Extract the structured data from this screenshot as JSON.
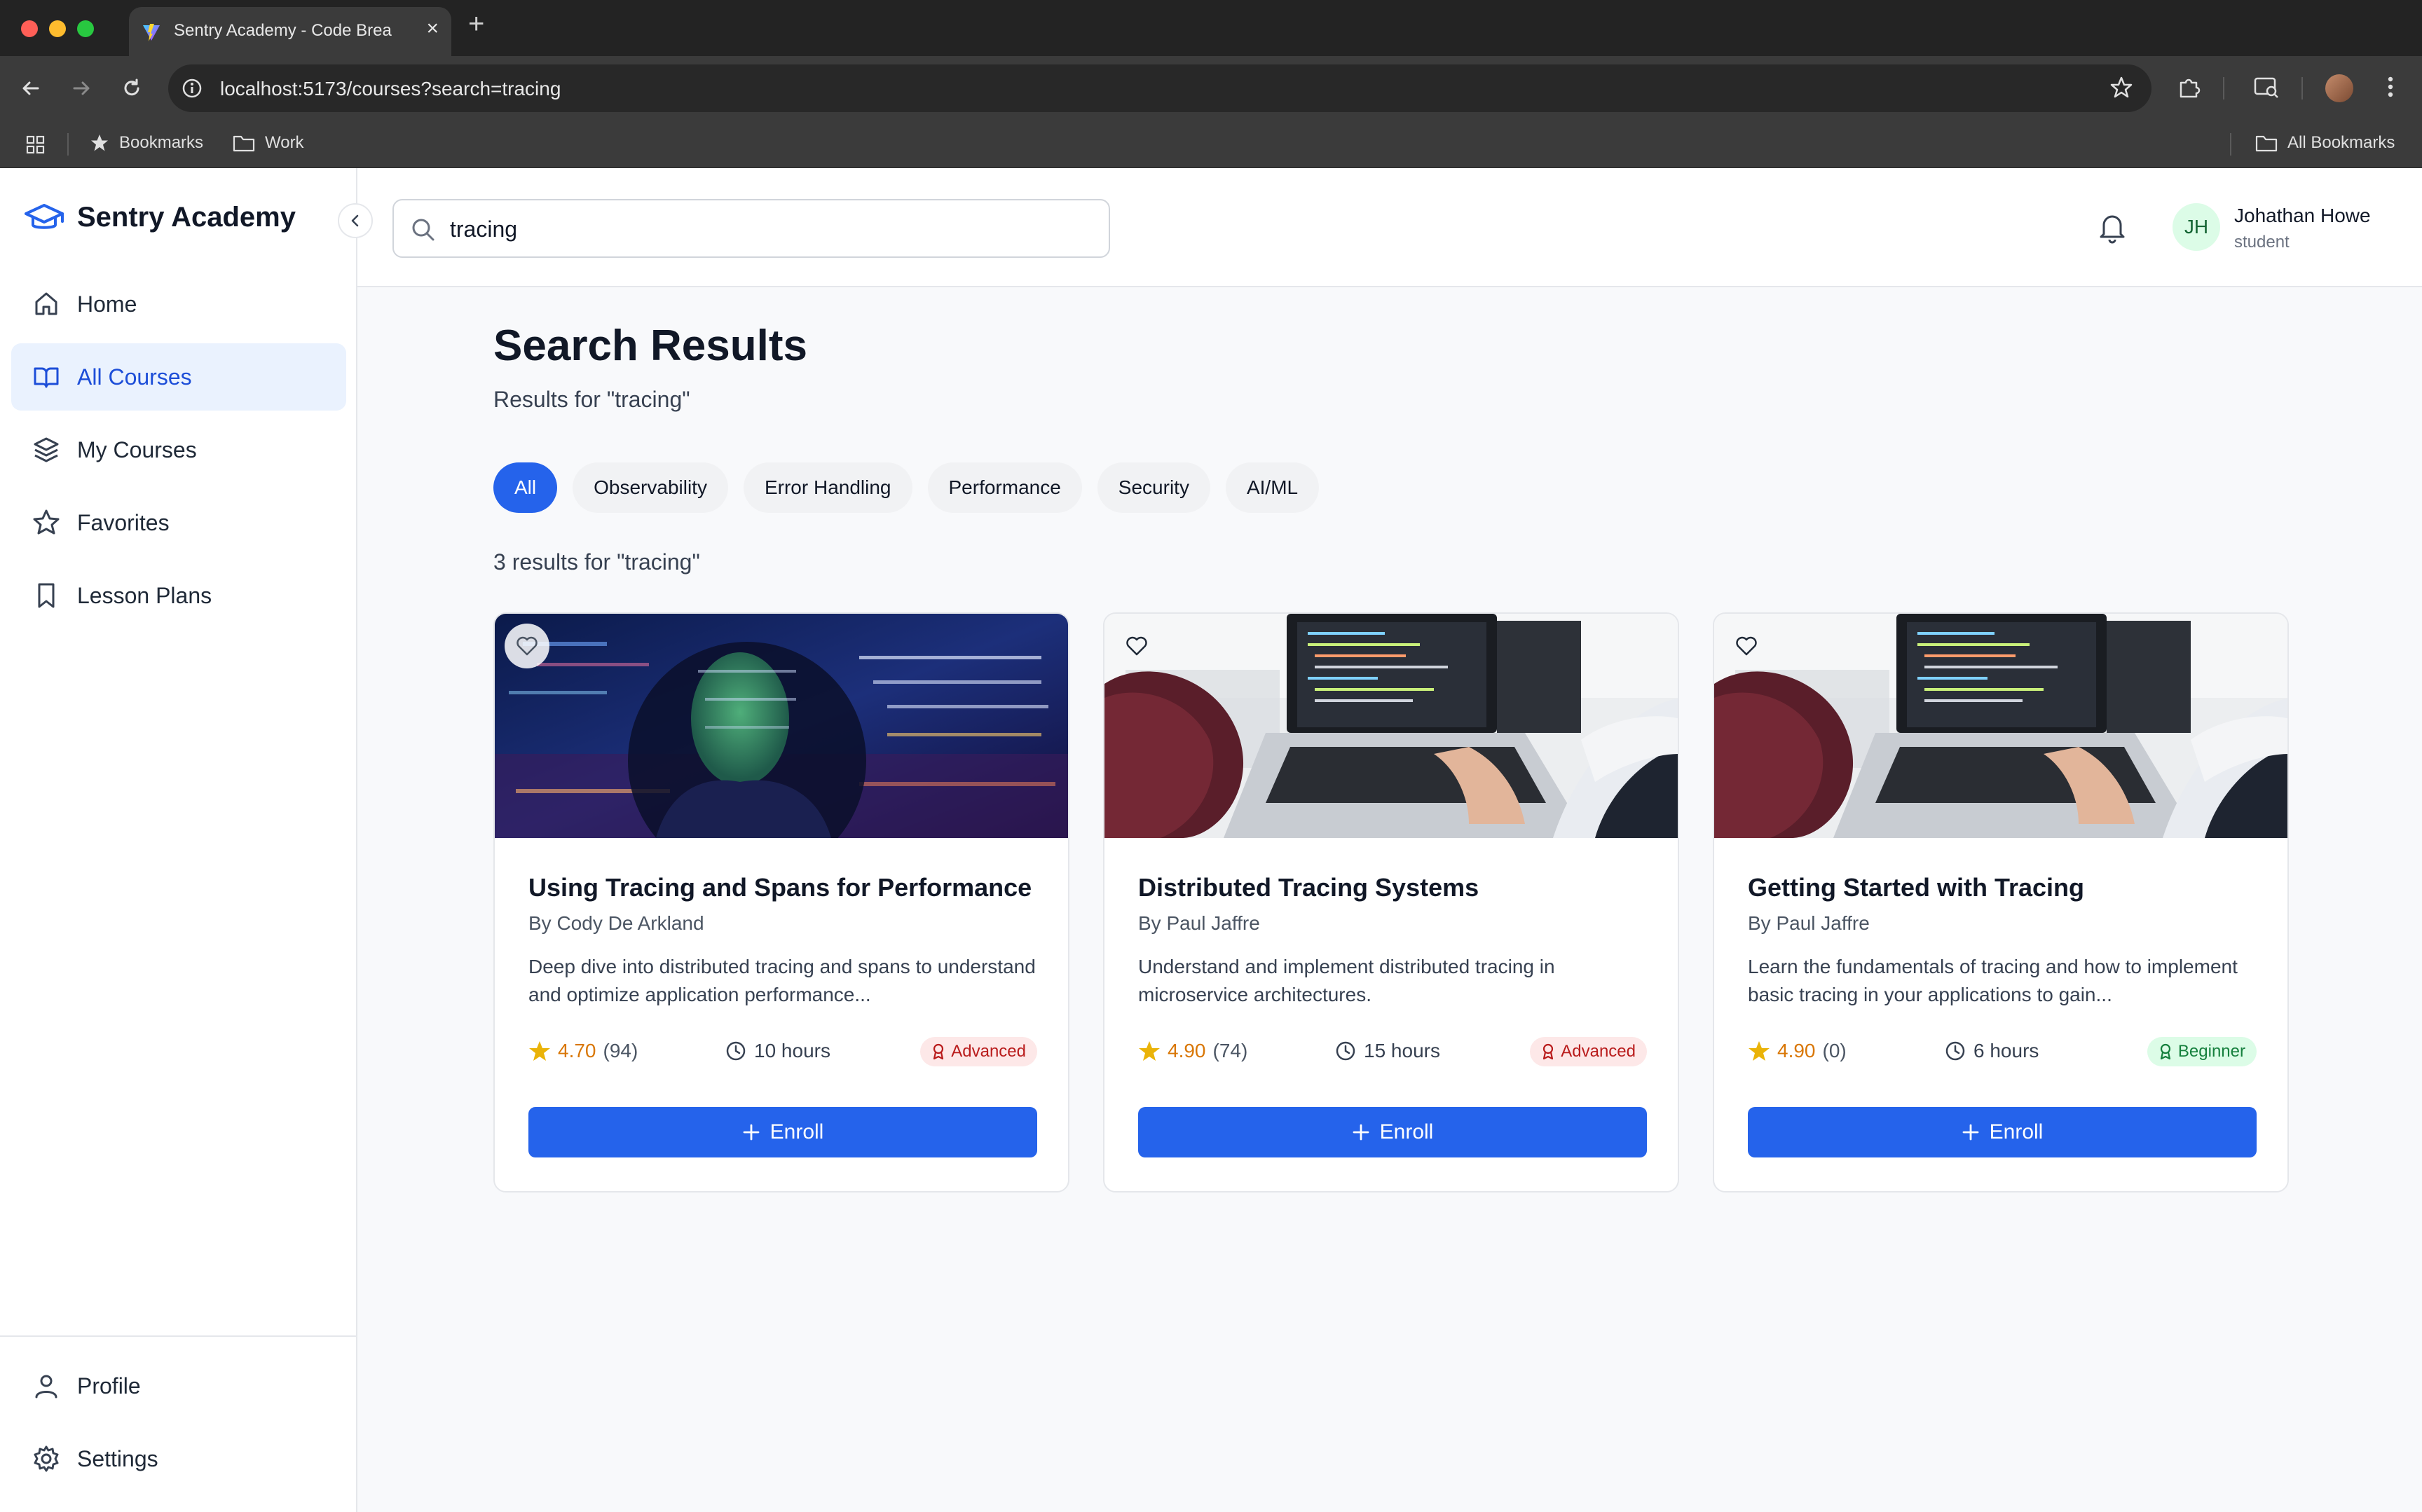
{
  "browser": {
    "tab_title": "Sentry Academy - Code Brea",
    "url": "localhost:5173/courses?search=tracing",
    "bookmarks": {
      "bookmarks_label": "Bookmarks",
      "work_label": "Work",
      "all_bookmarks_label": "All Bookmarks"
    }
  },
  "sidebar": {
    "brand": "Sentry Academy",
    "items": [
      {
        "label": "Home",
        "icon": "home-icon"
      },
      {
        "label": "All Courses",
        "icon": "book-open-icon",
        "active": true
      },
      {
        "label": "My Courses",
        "icon": "layers-icon"
      },
      {
        "label": "Favorites",
        "icon": "star-icon"
      },
      {
        "label": "Lesson Plans",
        "icon": "bookmark-icon"
      }
    ],
    "bottom_items": [
      {
        "label": "Profile",
        "icon": "user-icon"
      },
      {
        "label": "Settings",
        "icon": "gear-icon"
      }
    ]
  },
  "topbar": {
    "search_value": "tracing",
    "user": {
      "initials": "JH",
      "name": "Johathan Howe",
      "role": "student"
    }
  },
  "main": {
    "title": "Search Results",
    "subtitle": "Results for \"tracing\"",
    "filters": [
      "All",
      "Observability",
      "Error Handling",
      "Performance",
      "Security",
      "AI/ML"
    ],
    "active_filter": "All",
    "results_count": "3 results for \"tracing\""
  },
  "courses": [
    {
      "title": "Using Tracing and Spans for Performance",
      "author": "By Cody De Arkland",
      "description": "Deep dive into distributed tracing and spans to understand and optimize application performance...",
      "rating": "4.70",
      "reviews": "(94)",
      "duration": "10 hours",
      "level": "Advanced",
      "enroll_label": "Enroll",
      "image": "woman-code-projection-image"
    },
    {
      "title": "Distributed Tracing Systems",
      "author": "By Paul Jaffre",
      "description": "Understand and implement distributed tracing in microservice architectures.",
      "rating": "4.90",
      "reviews": "(74)",
      "duration": "15 hours",
      "level": "Advanced",
      "enroll_label": "Enroll",
      "image": "laptop-coding-image"
    },
    {
      "title": "Getting Started with Tracing",
      "author": "By Paul Jaffre",
      "description": "Learn the fundamentals of tracing and how to implement basic tracing in your applications to gain...",
      "rating": "4.90",
      "reviews": "(0)",
      "duration": "6 hours",
      "level": "Beginner",
      "enroll_label": "Enroll",
      "image": "laptop-coding-image"
    }
  ],
  "colors": {
    "accent": "#2563eb",
    "active_nav_bg": "#eaf2fe",
    "rating": "#d97706",
    "advanced_badge": "#b91c1c",
    "beginner_badge": "#15803d"
  }
}
